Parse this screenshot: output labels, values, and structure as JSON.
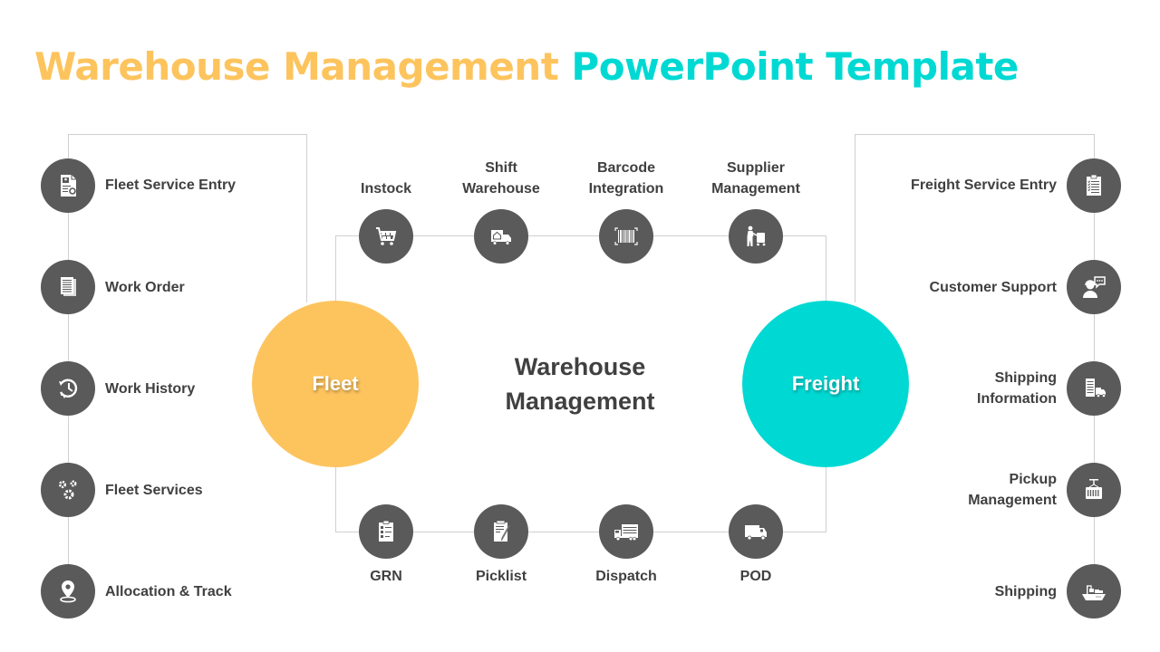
{
  "title": {
    "part1": "Warehouse Management",
    "part2": "PowerPoint Template",
    "part1_color": "#FDC45E",
    "part2_color": "#00D9D3"
  },
  "center": {
    "line1": "Warehouse",
    "line2": "Management"
  },
  "hubs": {
    "fleet": {
      "label": "Fleet",
      "color": "#FDC45E"
    },
    "freight": {
      "label": "Freight",
      "color": "#00D9D3"
    }
  },
  "fleet_items": [
    {
      "label": "Fleet Service Entry",
      "icon": "service-form-icon"
    },
    {
      "label": "Work Order",
      "icon": "document-icon"
    },
    {
      "label": "Work History",
      "icon": "history-icon"
    },
    {
      "label": "Fleet Services",
      "icon": "gears-icon"
    },
    {
      "label": "Allocation & Track",
      "icon": "location-pin-icon"
    }
  ],
  "freight_items": [
    {
      "label": "Freight Service Entry",
      "icon": "clipboard-checklist-icon"
    },
    {
      "label": "Customer Support",
      "icon": "customer-support-icon"
    },
    {
      "line1": "Shipping",
      "line2": "Information",
      "icon": "shipping-info-icon"
    },
    {
      "line1": "Pickup",
      "line2": "Management",
      "icon": "container-crane-icon"
    },
    {
      "label": "Shipping",
      "icon": "cargo-ship-icon"
    }
  ],
  "top_items": [
    {
      "line1": "",
      "line2": "Instock",
      "icon": "shopping-cart-icon"
    },
    {
      "line1": "Shift",
      "line2": "Warehouse",
      "icon": "moving-truck-icon"
    },
    {
      "line1": "Barcode",
      "line2": "Integration",
      "icon": "barcode-icon"
    },
    {
      "line1": "Supplier",
      "line2": "Management",
      "icon": "worker-trolley-icon"
    }
  ],
  "bottom_items": [
    {
      "label": "GRN",
      "icon": "checklist-icon"
    },
    {
      "label": "Picklist",
      "icon": "notepad-pen-icon"
    },
    {
      "label": "Dispatch",
      "icon": "lorry-icon"
    },
    {
      "label": "POD",
      "icon": "delivery-van-icon"
    }
  ]
}
